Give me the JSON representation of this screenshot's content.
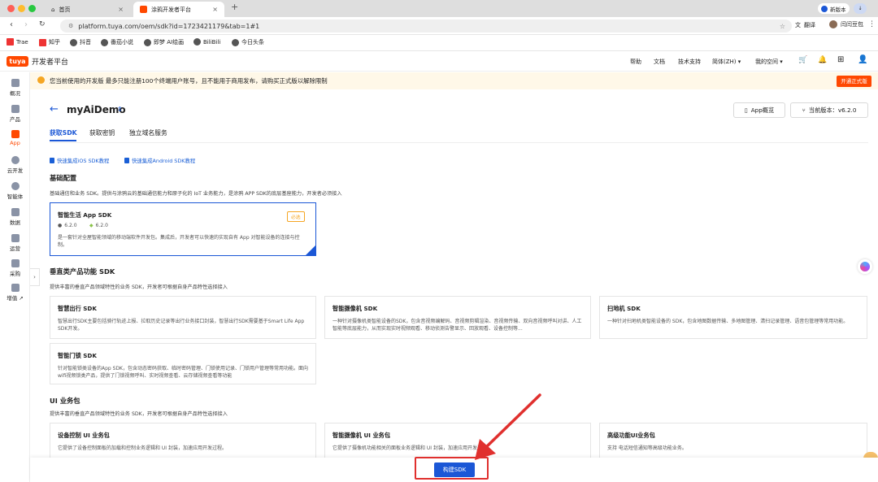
{
  "browser": {
    "tabs": [
      {
        "label": "首页",
        "icon": "home-icon"
      },
      {
        "label": "涂鸦开发者平台",
        "icon": "tuya-icon"
      }
    ],
    "new_tab": "+",
    "url": "platform.tuya.com/oem/sdk?id=1723421179&tab=1#1",
    "translate": "翻译",
    "user": "闫闫豆包",
    "new_version": "新版本",
    "bookmarks": [
      "Trae",
      "知乎",
      "抖音",
      "番茄小说",
      "即梦 AI绘画",
      "BiliBili",
      "今日头条"
    ]
  },
  "app": {
    "logo": "tuya",
    "title": "开发者平台",
    "nav": [
      "帮助",
      "文档",
      "技术支持",
      "简体(ZH) ▾",
      "我的空间 ▾"
    ]
  },
  "notice": {
    "text": "您当前使用的开发版 最多只能注册100个终端用户账号，且不能用于商用发布，请购买正式版以解除限制",
    "button": "开通正式版"
  },
  "sidebar": [
    {
      "label": "概况",
      "icon": "home-icon"
    },
    {
      "label": "产品",
      "icon": "product-icon"
    },
    {
      "label": "App",
      "icon": "app-icon"
    },
    {
      "label": "云开发",
      "icon": "cloud-icon"
    },
    {
      "label": "智能体",
      "icon": "agent-icon"
    },
    {
      "label": "数据",
      "icon": "chart-icon"
    },
    {
      "label": "运营",
      "icon": "operation-icon"
    },
    {
      "label": "采购",
      "icon": "cart-icon"
    },
    {
      "label": "增值 ↗",
      "icon": "value-icon"
    }
  ],
  "page": {
    "back": "←",
    "title": "myAiDemo",
    "title_switch": "⇕",
    "app_overview": "App概览",
    "current_version": "当前版本：v6.2.0",
    "tabs": [
      "获取SDK",
      "获取密钥",
      "独立域名服务"
    ],
    "links": [
      "快速集成iOS SDK教程",
      "快速集成Android SDK教程"
    ]
  },
  "basic": {
    "title": "基础配置",
    "desc": "基础通信和业务 SDK。提供与涂鸦云的基础通信能力和原子化的 IoT 业务能力，是涂鸦 APP SDK的底层基座能力，开发者必须接入",
    "card": {
      "title": "智能生活 App SDK",
      "badge": "必选",
      "ios_ver": "6.2.0",
      "android_ver": "6.2.0",
      "desc": "是一套针对全屋智能领域的移动端软件开发包。集成后，开发者可以快速的实现自有 App 对智能设备的连接与控制。"
    }
  },
  "vertical": {
    "title": "垂直类产品功能 SDK",
    "desc": "提供丰富的垂直产品领域特性的业务 SDK，开发者可根据自身产品特性选择接入",
    "cards": [
      {
        "title": "智慧出行 SDK",
        "desc": "智慧出行SDK主要包括骑行轨迹上报、拉取历史记录等出行业务接口封装，智慧出行SDK需要基于Smart Life App SDK开发。"
      },
      {
        "title": "智能摄像机 SDK",
        "desc": "一种针对摄像机类智能设备的SDK，包含音视频编解码、音视频剪辑渲染、音视频传输、双向音视频呼叫对讲、人工智能等底层能力，从而实现实时视频观看、移动侦测告警显示、回放观看、设备控制等..."
      },
      {
        "title": "扫地机 SDK",
        "desc": "一种针对扫地机类智能设备的 SDK，包含地图数据传输、多地图管理、清扫记录管理、语音包管理等常用功能。"
      },
      {
        "title": "智能门锁 SDK",
        "desc": "针对智能锁类设备的App SDK，包含动态密码获取、临时密码管理、门锁使用记录、门锁用户管理等常用功能。面向wifi视频锁类产品，提供了门锁视频呼叫、实时视频查看、云存储视频查看等功能"
      }
    ]
  },
  "ui": {
    "title": "UI 业务包",
    "desc": "提供丰富的垂直产品领域特性的业务 SDK，开发者可根据自身产品特性选择接入",
    "cards": [
      {
        "title": "设备控制 UI 业务包",
        "desc": "它提供了设备控制面板的加载和控制业务逻辑和 UI 封装，加速应用开发过程。"
      },
      {
        "title": "智能摄像机 UI 业务包",
        "desc": "它提供了摄像机功能相关的面板业务逻辑和 UI 封装，加速应用开发过程。"
      },
      {
        "title": "高级功能UI业务包",
        "desc": "支持 电话短信通知等高级功能业务。"
      }
    ]
  },
  "build_button": "构建SDK",
  "colors": {
    "brand": "#ff4800",
    "primary": "#1b57d6",
    "annotation": "#e0302e"
  }
}
